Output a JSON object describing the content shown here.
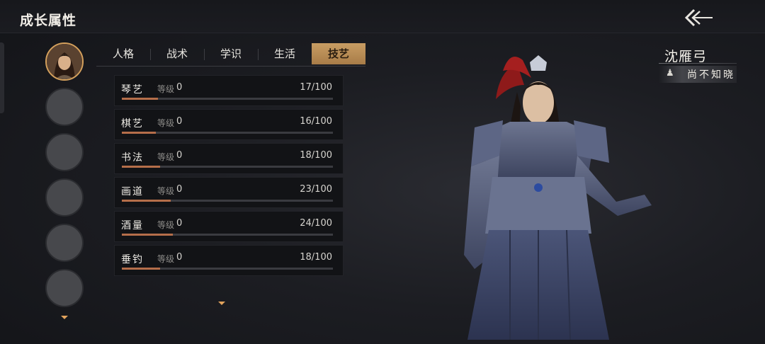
{
  "header": {
    "title": "成长属性",
    "back_icon": "double-arrow-left-icon"
  },
  "roster": {
    "slots": [
      {
        "state": "active",
        "icon": "character-portrait"
      },
      {
        "state": "empty"
      },
      {
        "state": "empty"
      },
      {
        "state": "empty"
      },
      {
        "state": "empty"
      },
      {
        "state": "empty"
      }
    ],
    "more_icon": "chevron-down-icon"
  },
  "tabs": [
    {
      "label": "人格"
    },
    {
      "label": "战术"
    },
    {
      "label": "学识"
    },
    {
      "label": "生活"
    },
    {
      "label": "技艺",
      "active": true
    }
  ],
  "level_label": "等级",
  "skills": [
    {
      "name": "琴艺",
      "level": "0",
      "score": "17/100",
      "progress": 0.17
    },
    {
      "name": "棋艺",
      "level": "0",
      "score": "16/100",
      "progress": 0.16
    },
    {
      "name": "书法",
      "level": "0",
      "score": "18/100",
      "progress": 0.18
    },
    {
      "name": "画道",
      "level": "0",
      "score": "23/100",
      "progress": 0.23
    },
    {
      "name": "酒量",
      "level": "0",
      "score": "24/100",
      "progress": 0.24
    },
    {
      "name": "垂钓",
      "level": "0",
      "score": "18/100",
      "progress": 0.18
    }
  ],
  "character": {
    "name": "沈雁弓",
    "status": "尚不知晓",
    "status_icon": "unknown-glyph-icon"
  },
  "colors": {
    "accent": "#c89d63",
    "progress": "#b56e4a",
    "avatar_ring": "#d4a05c"
  }
}
